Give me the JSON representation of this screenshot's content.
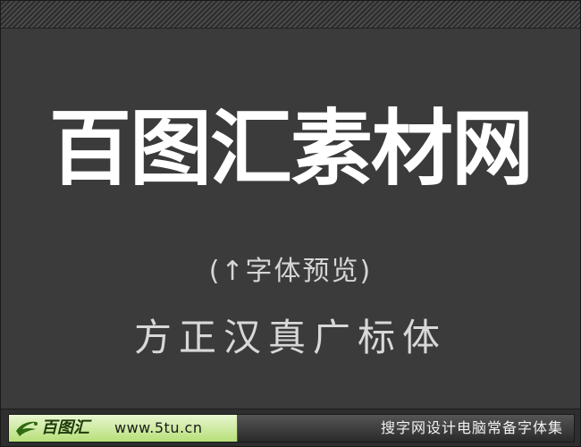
{
  "preview": {
    "title": "百图汇素材网",
    "preview_label": "(↑字体预览)",
    "font_name": "方正汉真广标体"
  },
  "footer": {
    "logo_text": "百图汇",
    "site_url": "www.5tu.cn",
    "tagline": "搜字网设计电脑常备字体集"
  },
  "colors": {
    "background": "#3b3b3b",
    "title": "#ffffff",
    "accent_green": "#b6df78"
  }
}
